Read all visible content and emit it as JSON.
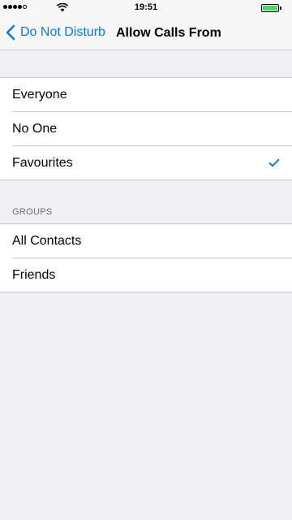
{
  "status_bar": {
    "time": "19:51",
    "signal_icon": "signal-dots-icon",
    "wifi_icon": "wifi-icon",
    "battery_icon": "battery-icon",
    "battery_color": "#4cd964"
  },
  "nav": {
    "back_label": "Do Not Disturb",
    "back_icon": "chevron-left-icon",
    "title": "Allow Calls From",
    "accent_color": "#0a7ad6"
  },
  "options": [
    {
      "label": "Everyone",
      "selected": false
    },
    {
      "label": "No One",
      "selected": false
    },
    {
      "label": "Favourites",
      "selected": true
    }
  ],
  "groups_section": {
    "header": "GROUPS",
    "items": [
      {
        "label": "All Contacts"
      },
      {
        "label": "Friends"
      }
    ]
  }
}
